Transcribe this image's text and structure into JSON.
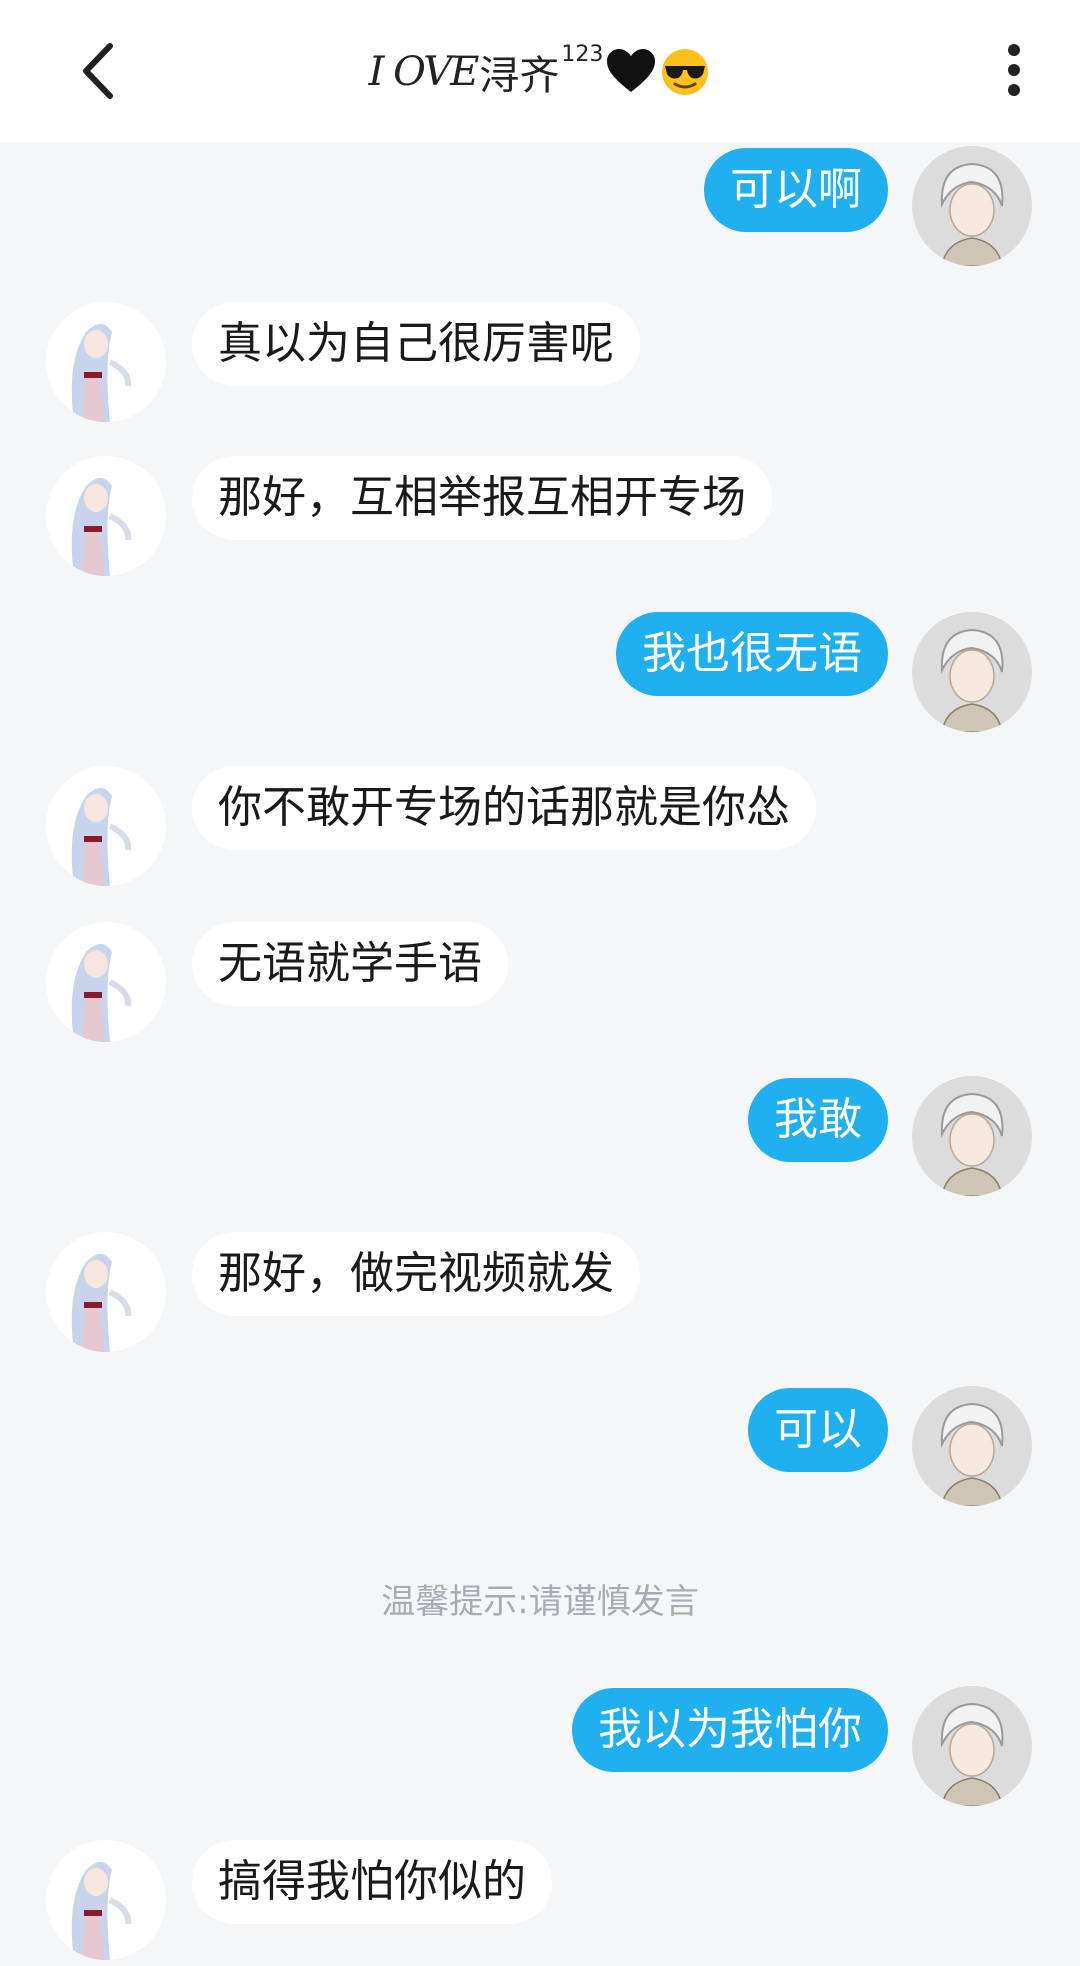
{
  "header": {
    "title_script": "I OVE",
    "title_name": "浔齐",
    "title_sup": "123",
    "back_icon": "chevron-left-icon",
    "more_icon": "more-vertical-icon"
  },
  "messages": [
    {
      "side": "self",
      "text": "可以啊"
    },
    {
      "side": "other",
      "text": "真以为自己很厉害呢"
    },
    {
      "side": "other",
      "text": "那好，互相举报互相开专场"
    },
    {
      "side": "self",
      "text": "我也很无语"
    },
    {
      "side": "other",
      "text": "你不敢开专场的话那就是你怂"
    },
    {
      "side": "other",
      "text": "无语就学手语"
    },
    {
      "side": "self",
      "text": "我敢"
    },
    {
      "side": "other",
      "text": "那好，做完视频就发"
    },
    {
      "side": "self",
      "text": "可以"
    },
    {
      "side": "self",
      "text": "我以为我怕你"
    },
    {
      "side": "other",
      "text": "搞得我怕你似的"
    }
  ],
  "system_tip": "温馨提示:请谨慎发言",
  "colors": {
    "self_bubble": "#20b0f0",
    "other_bubble": "#ffffff",
    "background": "#f4f6f8"
  }
}
